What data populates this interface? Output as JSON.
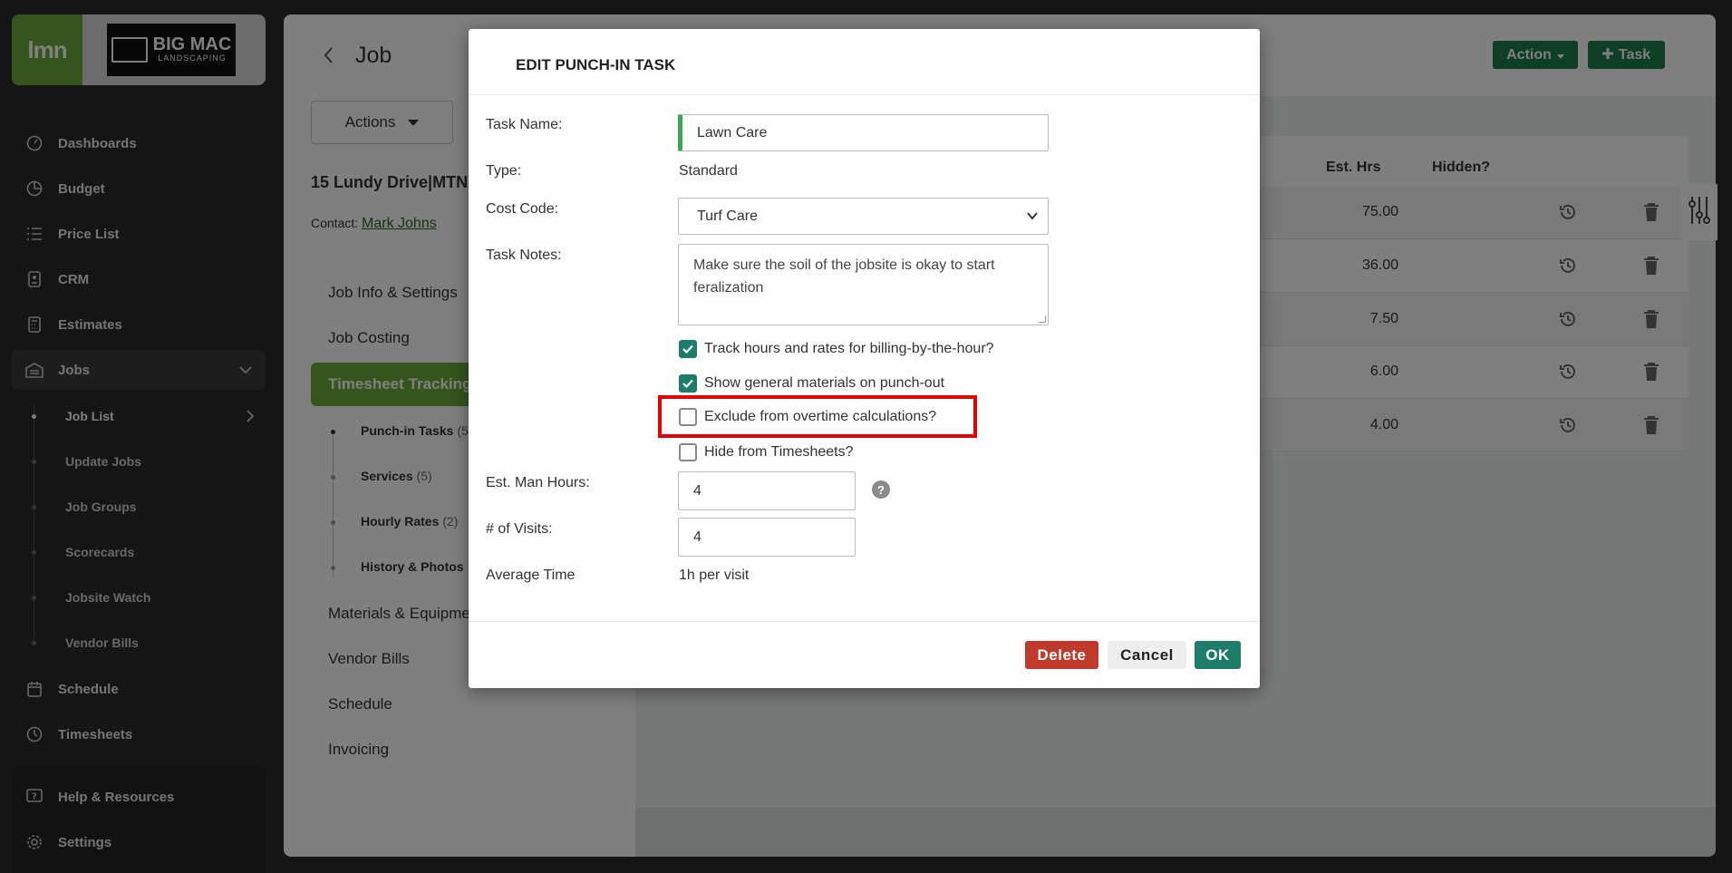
{
  "sidebar": {
    "logo_text": "lmn",
    "brand_name": "BIG MAC",
    "brand_sub": "LANDSCAPING",
    "items": [
      {
        "label": "Dashboards",
        "icon": "gauge-icon"
      },
      {
        "label": "Budget",
        "icon": "pie-chart-icon"
      },
      {
        "label": "Price List",
        "icon": "list-icon"
      },
      {
        "label": "CRM",
        "icon": "contact-card-icon"
      },
      {
        "label": "Estimates",
        "icon": "calculator-icon"
      },
      {
        "label": "Jobs",
        "icon": "building-icon"
      },
      {
        "label": "Schedule",
        "icon": "calendar-icon"
      },
      {
        "label": "Timesheets",
        "icon": "clock-icon"
      },
      {
        "label": "Help & Resources",
        "icon": "help-icon"
      },
      {
        "label": "Settings",
        "icon": "gear-icon"
      }
    ],
    "job_subitems": [
      "Job List",
      "Update Jobs",
      "Job Groups",
      "Scorecards",
      "Jobsite Watch",
      "Vendor Bills"
    ]
  },
  "page": {
    "title": "Job",
    "actions_label": "Actions",
    "address": "15 Lundy Drive|MTN",
    "contact_label": "Contact:",
    "contact_name": "Mark Johns",
    "action_btn": "Action",
    "task_btn": "Task"
  },
  "job_nav": {
    "items": [
      "Job Info & Settings",
      "Job Costing",
      "Timesheet Tracking",
      "Materials & Equipme",
      "Vendor Bills",
      "Schedule",
      "Invoicing"
    ],
    "subitems": [
      {
        "label": "Punch-in Tasks",
        "count": "(5"
      },
      {
        "label": "Services",
        "count": "(5)"
      },
      {
        "label": "Hourly Rates",
        "count": "(2)"
      },
      {
        "label": "History & Photos",
        "count": ""
      }
    ]
  },
  "table": {
    "headers": {
      "est_hrs": "Est. Hrs",
      "hidden": "Hidden?"
    },
    "est_hrs": [
      "75.00",
      "36.00",
      "7.50",
      "6.00",
      "4.00"
    ]
  },
  "modal": {
    "title": "EDIT PUNCH-IN TASK",
    "task_name_label": "Task Name:",
    "task_name_value": "Lawn Care",
    "type_label": "Type:",
    "type_value": "Standard",
    "cost_code_label": "Cost Code:",
    "cost_code_value": "Turf Care",
    "task_notes_label": "Task Notes:",
    "task_notes_value": "Make sure the soil of the jobsite is okay to start feralization",
    "chk_track": "Track hours and rates for billing-by-the-hour?",
    "chk_general": "Show general materials on punch-out",
    "chk_exclude": "Exclude from overtime calculations?",
    "chk_hide": "Hide from Timesheets?",
    "est_man_hours_label": "Est. Man Hours:",
    "est_man_hours_value": "4",
    "visits_label": "# of Visits:",
    "visits_value": "4",
    "avg_time_label": "Average Time",
    "avg_time_value": "1h per visit",
    "help_glyph": "?",
    "delete_label": "Delete",
    "cancel_label": "Cancel",
    "ok_label": "OK"
  },
  "colors": {
    "brand_green": "#6bab3a",
    "action_green": "#1e7d4d",
    "delete_red": "#c0392b",
    "highlight_red": "#e60000"
  }
}
